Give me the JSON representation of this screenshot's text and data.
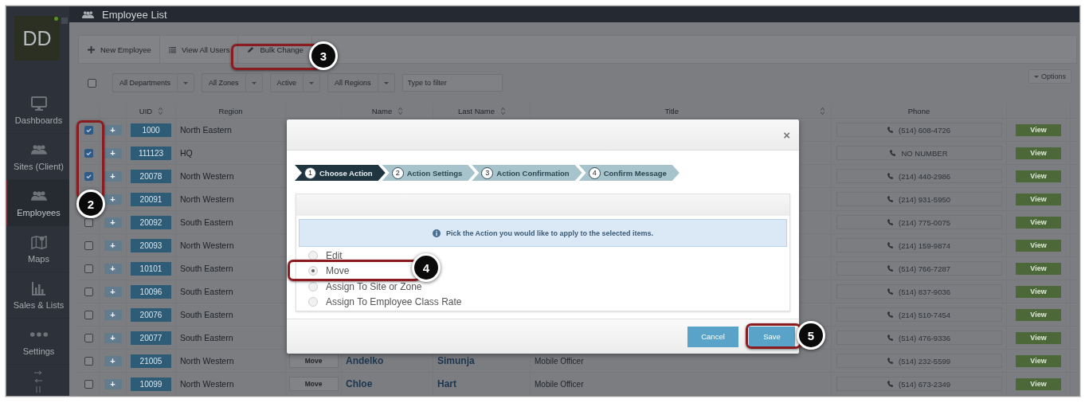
{
  "sidebar": {
    "avatar": "DD",
    "online": true,
    "items": [
      {
        "label": "Dashboards",
        "selected": false
      },
      {
        "label": "Sites (Client)",
        "selected": false
      },
      {
        "label": "Employees",
        "selected": true
      },
      {
        "label": "Maps",
        "selected": false
      },
      {
        "label": "Sales & Lists",
        "selected": false
      },
      {
        "label": "Settings",
        "selected": false
      }
    ]
  },
  "header": {
    "title": "Employee List"
  },
  "toolbar": [
    {
      "label": "New Employee"
    },
    {
      "label": "View All Users"
    },
    {
      "label": "Bulk Change"
    }
  ],
  "filters": {
    "select_all_checked": false,
    "dropdowns": [
      "All Departments",
      "All Zones",
      "Active",
      "All Regions"
    ],
    "search": {
      "placeholder": "Type to filter"
    },
    "options": "Options"
  },
  "table": {
    "columns": [
      {
        "label": "UID",
        "sortable": true
      },
      {
        "label": "Region",
        "sortable": false
      },
      {
        "label": "Name",
        "sortable": true
      },
      {
        "label": "Last Name",
        "sortable": true
      },
      {
        "label": "Title",
        "sortable": true
      },
      {
        "label": "Phone",
        "sortable": false
      }
    ],
    "rows": [
      {
        "checked": true,
        "expand": "+",
        "uid": "1000",
        "region": "North Eastern",
        "phone": "(514) 608-4726",
        "view": "View"
      },
      {
        "checked": true,
        "expand": "+",
        "uid": "111123",
        "region": "HQ",
        "phone": "NO NUMBER",
        "view": "View"
      },
      {
        "checked": true,
        "expand": "+",
        "uid": "20078",
        "region": "North Western",
        "phone": "(214) 440-2986",
        "view": "View"
      },
      {
        "expand": "+",
        "uid": "20091",
        "region": "North Western",
        "phone": "(214) 931-5950",
        "view": "View"
      },
      {
        "checked": false,
        "expand": "+",
        "uid": "20092",
        "region": "South Eastern",
        "phone": "(214) 775-0075",
        "view": "View"
      },
      {
        "checked": false,
        "expand": "+",
        "uid": "20093",
        "region": "North Western",
        "phone": "(214) 159-9874",
        "view": "View"
      },
      {
        "checked": false,
        "expand": "+",
        "uid": "10101",
        "region": "South Eastern",
        "phone": "(514) 766-7287",
        "view": "View"
      },
      {
        "checked": false,
        "expand": "+",
        "uid": "10096",
        "region": "South Eastern",
        "phone": "(514) 837-9036",
        "view": "View"
      },
      {
        "checked": false,
        "expand": "+",
        "uid": "20076",
        "region": "South Eastern",
        "phone": "(214) 510-7454",
        "view": "View"
      },
      {
        "checked": false,
        "expand": "+",
        "uid": "20077",
        "region": "South Eastern",
        "phone": "(514) 476-9336",
        "view": "View"
      },
      {
        "checked": false,
        "expand": "+",
        "uid": "21005",
        "region": "North Western",
        "action": "Move",
        "name": "Andelko",
        "last_name": "Simunja",
        "title": "Mobile Officer",
        "phone": "(514) 232-5599",
        "view": "View"
      },
      {
        "checked": false,
        "expand": "+",
        "uid": "10099",
        "region": "North Western",
        "action": "Move",
        "name": "Chloe",
        "last_name": "Hart",
        "title": "Mobile Officer",
        "phone": "(514) 673-2349",
        "view": "View"
      }
    ]
  },
  "modal": {
    "close": "×",
    "steps": [
      {
        "number": "1",
        "label": "Choose Action",
        "selected": true
      },
      {
        "number": "2",
        "label": "Action Settings",
        "selected": false
      },
      {
        "number": "3",
        "label": "Action Confirmation",
        "selected": false
      },
      {
        "number": "4",
        "label": "Confirm Message",
        "selected": false
      }
    ],
    "info": "Pick the Action you would like to apply to the selected items.",
    "options": [
      {
        "label": "Edit",
        "selected": false
      },
      {
        "label": "Move",
        "selected": true
      },
      {
        "label": "Assign To Site or Zone",
        "selected": false
      },
      {
        "label": "Assign To Employee Class Rate",
        "selected": false
      }
    ],
    "buttons": [
      {
        "label": "Cancel",
        "kind": "secondary"
      },
      {
        "label": "Save",
        "kind": "primary"
      }
    ]
  },
  "annotations": [
    {
      "number": "2"
    },
    {
      "number": "3"
    },
    {
      "number": "4"
    },
    {
      "number": "5"
    }
  ]
}
